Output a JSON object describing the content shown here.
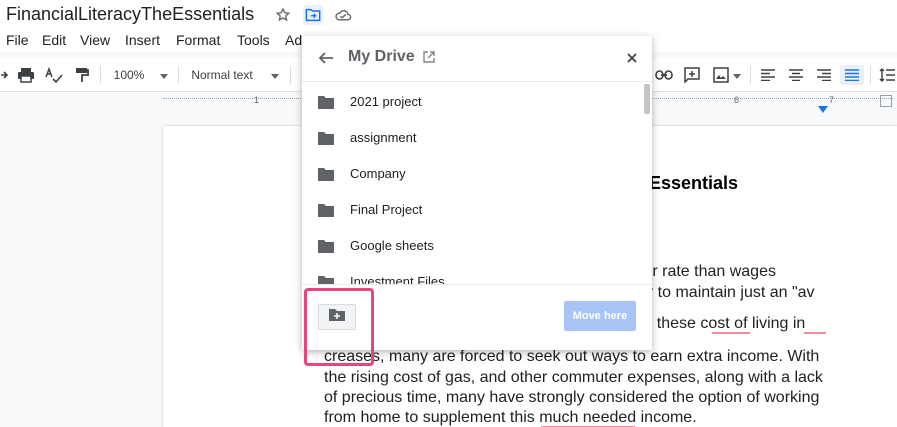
{
  "title_bar": {
    "doc_title": "FinancialLiteracyTheEssentials"
  },
  "menu": {
    "items": [
      "File",
      "Edit",
      "View",
      "Insert",
      "Format",
      "Tools",
      "Ad"
    ]
  },
  "toolbar": {
    "zoom": "100%",
    "style": "Normal text"
  },
  "ruler": {
    "numbers": [
      "1",
      "6",
      "7"
    ]
  },
  "document": {
    "heading_fragment": "Essentials",
    "lines": [
      "ter rate than wages",
      "er to maintain just an \"av",
      "th these cost of living in",
      "creases, many are forced to seek out ways to earn extra income. With",
      "the rising cost of gas, and other commuter expenses, along with a lack",
      "of precious time, many have strongly considered the option of working",
      "from home to supplement this much needed income."
    ]
  },
  "dialog": {
    "title": "My Drive",
    "folders": [
      "2021 project",
      "assignment",
      "Company",
      "Final Project",
      "Google sheets",
      "Investment Files"
    ],
    "move_here_label": "Move here"
  },
  "colors": {
    "accent": "#1a73e8",
    "move_button": "#a7c4f5",
    "highlight": "#e8457a",
    "spell_underline": "#f28b9c"
  },
  "icons": [
    "star-icon",
    "move-to-folder-icon",
    "cloud-status-icon",
    "back-arrow-icon",
    "open-in-new-icon",
    "close-icon",
    "folder-icon",
    "new-folder-icon"
  ]
}
